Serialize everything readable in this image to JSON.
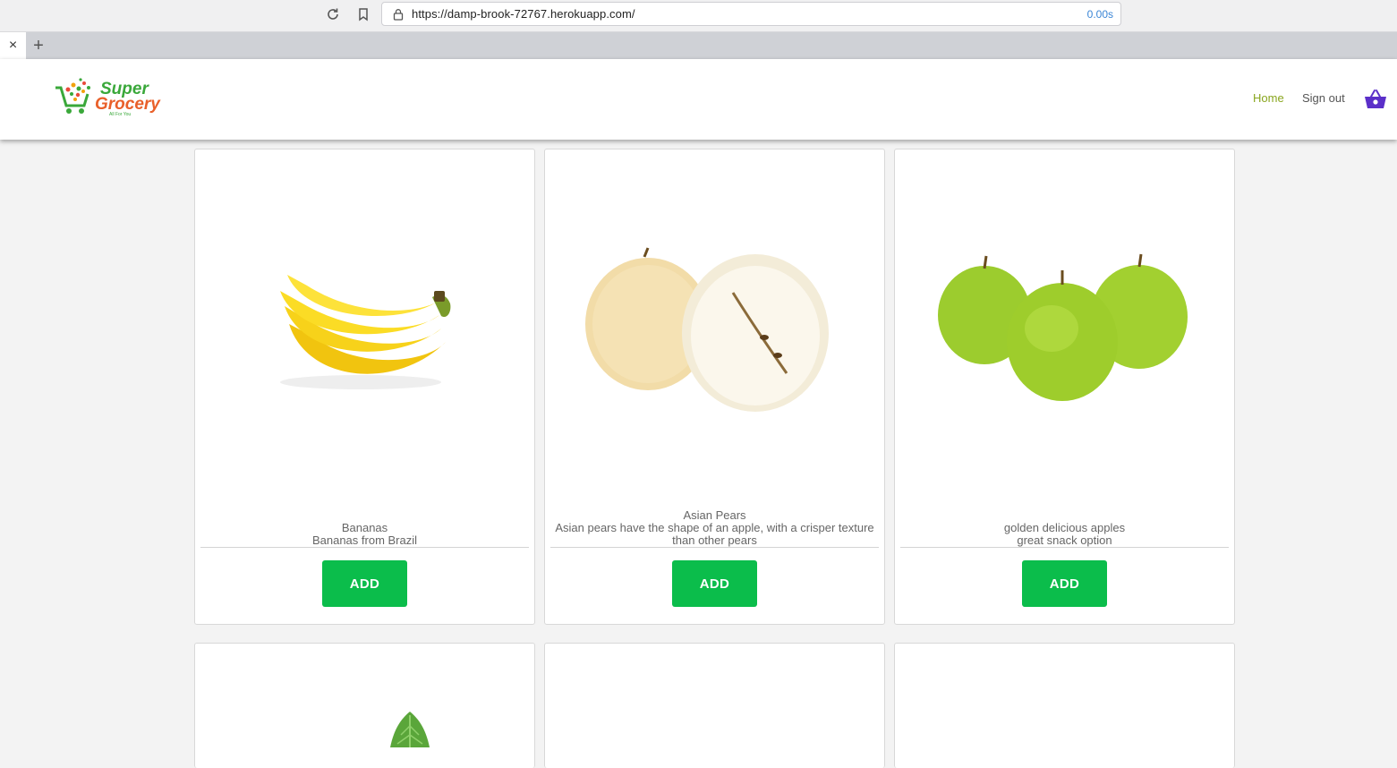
{
  "browser": {
    "url": "https://damp-brook-72767.herokuapp.com/",
    "load_time": "0.00s",
    "tab_close": "×",
    "new_tab": "+"
  },
  "header": {
    "logo_line1": "Super",
    "logo_line2": "Grocery",
    "logo_tagline": "All For You",
    "nav": {
      "home": "Home",
      "sign_out": "Sign out"
    },
    "colors": {
      "home_link": "#8aa61f",
      "cart_icon": "#5b2fc9"
    }
  },
  "products": [
    {
      "name": "Bananas",
      "description": "Bananas from Brazil",
      "button": "ADD",
      "image": "banana-bunch"
    },
    {
      "name": "Asian Pears",
      "description": "Asian pears have the shape of an apple, with a crisper texture than other pears",
      "button": "ADD",
      "image": "asian-pears"
    },
    {
      "name": "golden delicious apples",
      "description": "great snack option",
      "button": "ADD",
      "image": "green-apples"
    }
  ],
  "accent_color": "#0bbd4b"
}
